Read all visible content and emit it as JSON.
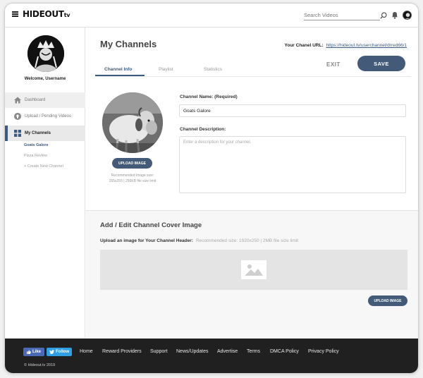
{
  "header": {
    "logo_main": "HIDEOUT",
    "logo_suffix": "tv",
    "search_placeholder": "Search Videos"
  },
  "sidebar": {
    "welcome": "Welcome, Username",
    "items": [
      {
        "label": "Dashboard"
      },
      {
        "label": "Upload / Pending Videos"
      },
      {
        "label": "My Channels"
      }
    ],
    "channels": [
      {
        "label": "Goats Galore"
      },
      {
        "label": "Pizza Review"
      },
      {
        "label": "+ Create New Channel"
      }
    ]
  },
  "main": {
    "title": "My Channels",
    "url_label": "Your Chanel URL:",
    "url_value": "https://hideout.tv/userchannel/drred66/1",
    "tabs": [
      {
        "label": "Channel Info"
      },
      {
        "label": "Playlist"
      },
      {
        "label": "Statistics"
      }
    ],
    "exit_label": "EXIT",
    "save_label": "SAVE",
    "upload_image_label": "UPLOAD IMAGE",
    "image_hint_line1": "Recommended image size:",
    "image_hint_line2": "255x255 | 256KB file size limit",
    "name_label": "Channel Name: (Required)",
    "name_value": "Goats Galore",
    "desc_label": "Channel Description:",
    "desc_placeholder": "Enter a description for your channel."
  },
  "cover": {
    "title": "Add / Edit Channel Cover Image",
    "subtitle": "Upload an image for Your Channel Header:",
    "hint": "Recommended size: 1920x250 | 2MB file size limit",
    "upload_label": "UPLOAD IMAGE"
  },
  "footer": {
    "like_label": "Like",
    "follow_label": "Follow",
    "links": [
      {
        "label": "Home"
      },
      {
        "label": "Reward Providers"
      },
      {
        "label": "Support"
      },
      {
        "label": "News/Updates"
      },
      {
        "label": "Advertise"
      },
      {
        "label": "Terms"
      },
      {
        "label": "DMCA Policy"
      },
      {
        "label": "Privacy Policy"
      }
    ],
    "copyright": "© Hideout.tv 2019"
  },
  "colors": {
    "accent": "#435a78",
    "footer_bg": "#202020",
    "facebook": "#4a6ab8",
    "twitter": "#2f9fe6"
  },
  "icons": [
    "hamburger-icon",
    "search-icon",
    "bell-icon",
    "home-icon",
    "upload-icon",
    "grid-icon",
    "image-placeholder-icon",
    "facebook-icon",
    "twitter-icon"
  ]
}
